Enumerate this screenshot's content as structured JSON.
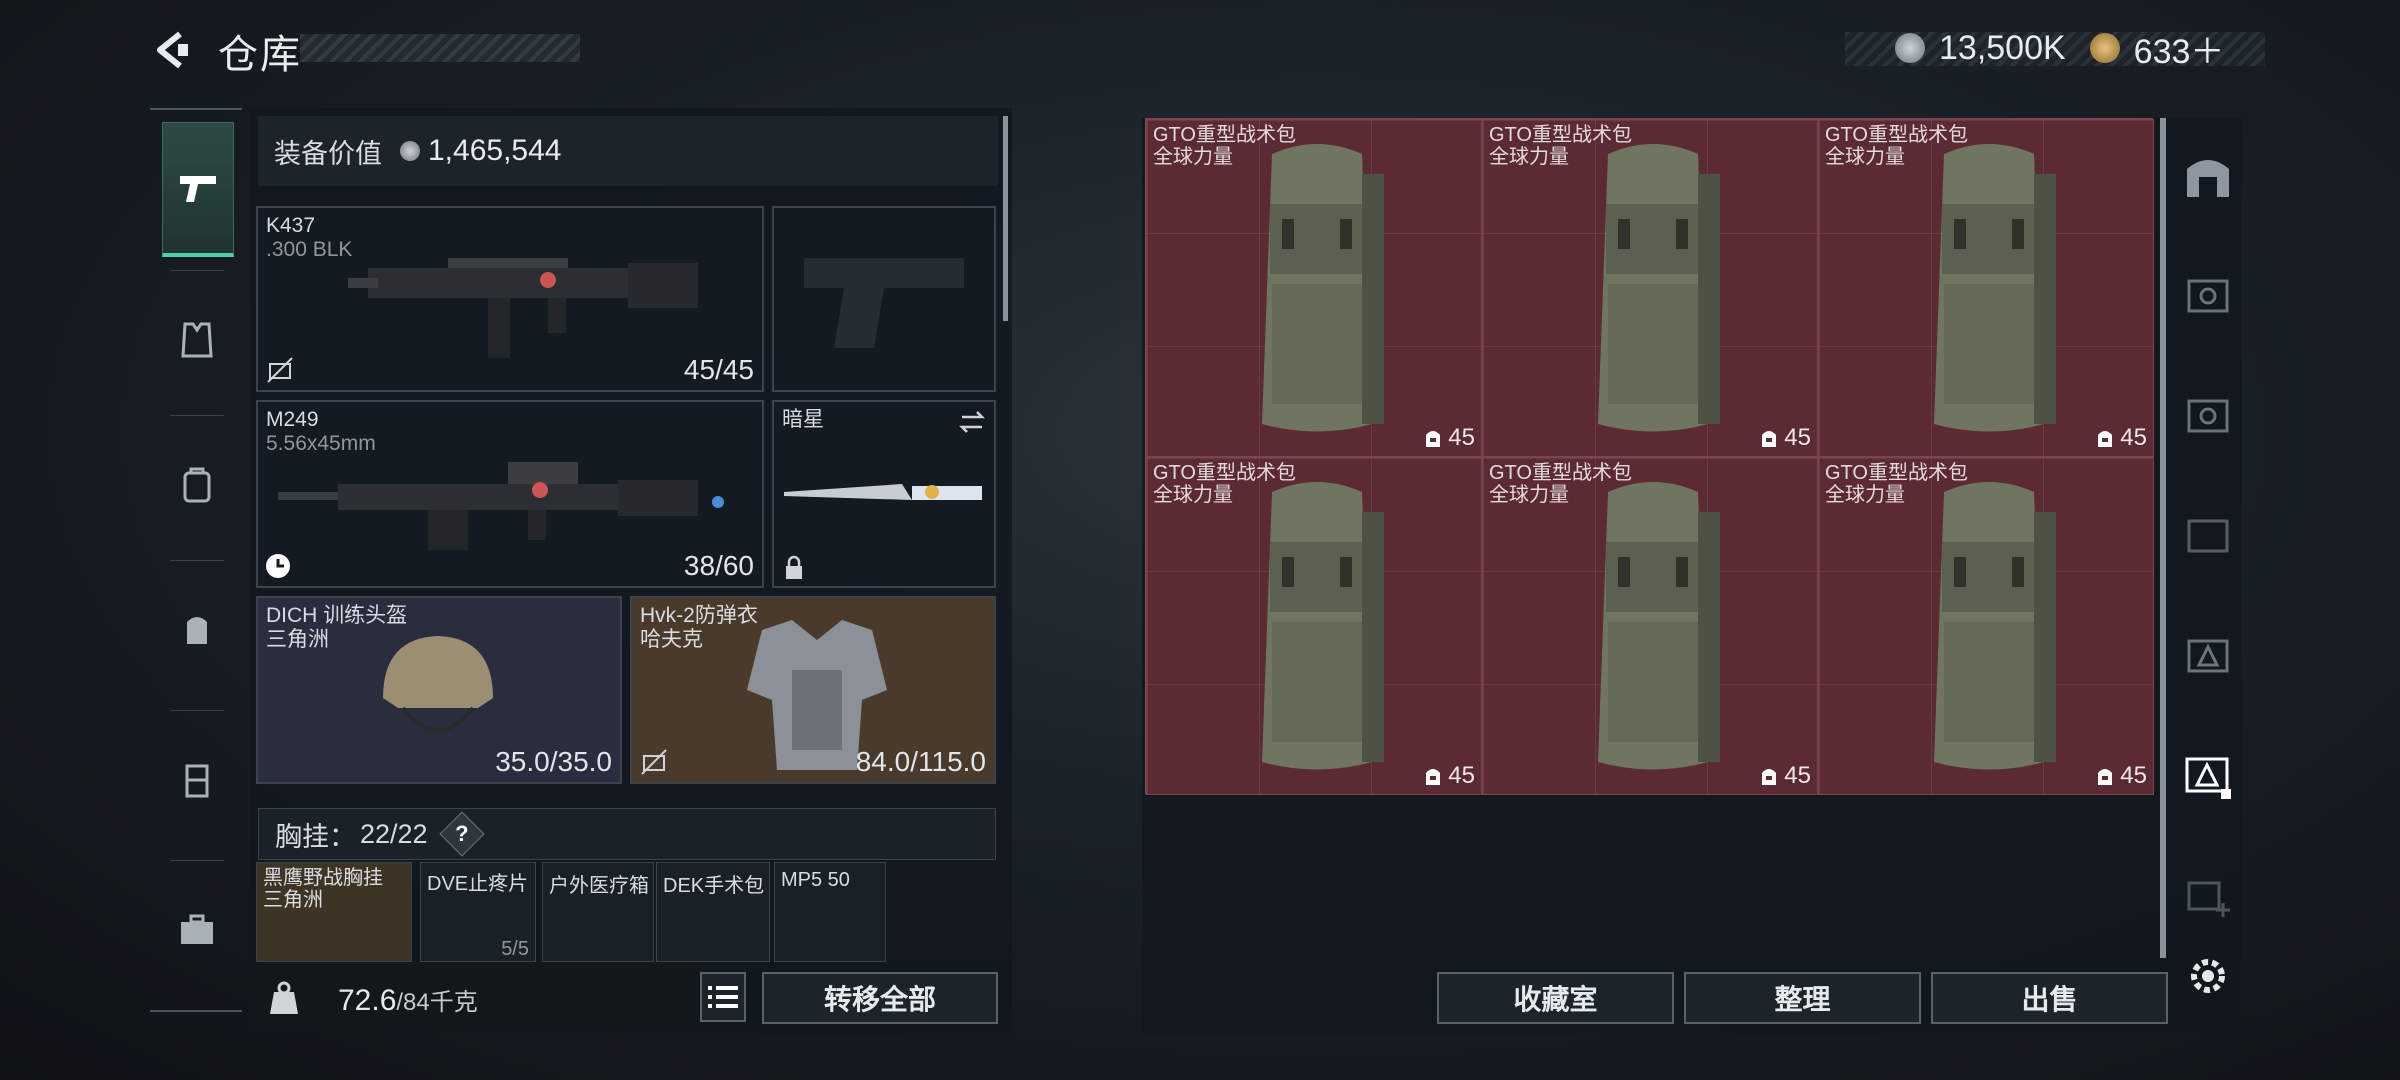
{
  "header": {
    "title": "仓库",
    "coins": {
      "silver": "13,500K",
      "gold": "633＋"
    }
  },
  "equipment": {
    "value_label": "装备价值",
    "value": "1,465,544",
    "primary": {
      "name": "K437",
      "caliber": ".300 BLK",
      "ammo": "45/45"
    },
    "secondary": {
      "name": "M249",
      "caliber": "5.56x45mm",
      "ammo": "38/60"
    },
    "melee": {
      "name": "暗星"
    },
    "helmet": {
      "name": "DICH 训练头盔",
      "faction": "三角洲",
      "durability": "35.0/35.0"
    },
    "armor": {
      "name": "Hvk-2防弹衣",
      "faction": "哈夫克",
      "durability": "84.0/115.0"
    },
    "chest_rig": {
      "label": "胸挂：",
      "capacity": "22/22",
      "help": "?"
    },
    "chest_items": [
      {
        "name": "黑鹰野战胸挂",
        "sub": "三角洲"
      },
      {
        "name": "DVE止疼片",
        "sub": "5/5"
      },
      {
        "name": "户外医疗箱",
        "sub": ""
      },
      {
        "name": "DEK手术包",
        "sub": ""
      },
      {
        "name": "MP5 50",
        "sub": ""
      }
    ],
    "weight": {
      "current": "72.6",
      "max": "/84千克"
    },
    "transfer_all": "转移全部"
  },
  "storage": {
    "items": [
      {
        "name": "GTO重型战术包",
        "brand": "全球力量",
        "count": "45"
      },
      {
        "name": "GTO重型战术包",
        "brand": "全球力量",
        "count": "45"
      },
      {
        "name": "GTO重型战术包",
        "brand": "全球力量",
        "count": "45"
      },
      {
        "name": "GTO重型战术包",
        "brand": "全球力量",
        "count": "45"
      },
      {
        "name": "GTO重型战术包",
        "brand": "全球力量",
        "count": "45"
      },
      {
        "name": "GTO重型战术包",
        "brand": "全球力量",
        "count": "45"
      }
    ],
    "buttons": {
      "collection": "收藏室",
      "sort": "整理",
      "sell": "出售"
    }
  },
  "colors": {
    "accent": "#4fd0a6",
    "cell_bg": "#5c2a33",
    "armor_bg": "#4a3a2c",
    "helmet_bg": "#2a2d3e"
  }
}
